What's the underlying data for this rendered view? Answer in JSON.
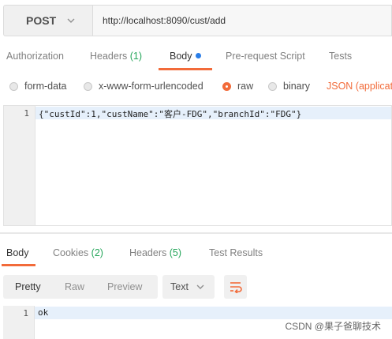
{
  "request": {
    "method": "POST",
    "url": "http://localhost:8090/cust/add"
  },
  "request_tabs": {
    "authorization": "Authorization",
    "headers": "Headers",
    "headers_count": "(1)",
    "body": "Body",
    "pre_request": "Pre-request Script",
    "tests": "Tests"
  },
  "body_types": {
    "form_data": "form-data",
    "urlencoded": "x-www-form-urlencoded",
    "raw": "raw",
    "binary": "binary",
    "content_type": "JSON (applicatio",
    "selected": "raw"
  },
  "editor": {
    "line_number": "1",
    "code": "{\"custId\":1,\"custName\":\"客户-FDG\",\"branchId\":\"FDG\"}"
  },
  "response_tabs": {
    "body": "Body",
    "cookies": "Cookies",
    "cookies_count": "(2)",
    "headers": "Headers",
    "headers_count": "(5)",
    "test_results": "Test Results"
  },
  "response_toolbar": {
    "pretty": "Pretty",
    "raw": "Raw",
    "preview": "Preview",
    "format": "Text"
  },
  "response_editor": {
    "line_number": "1",
    "code": "ok"
  },
  "watermark": "CSDN @果子爸聊技术",
  "colors": {
    "accent": "#f26b3a",
    "count": "#26a65b",
    "dot": "#2a7ee8"
  }
}
